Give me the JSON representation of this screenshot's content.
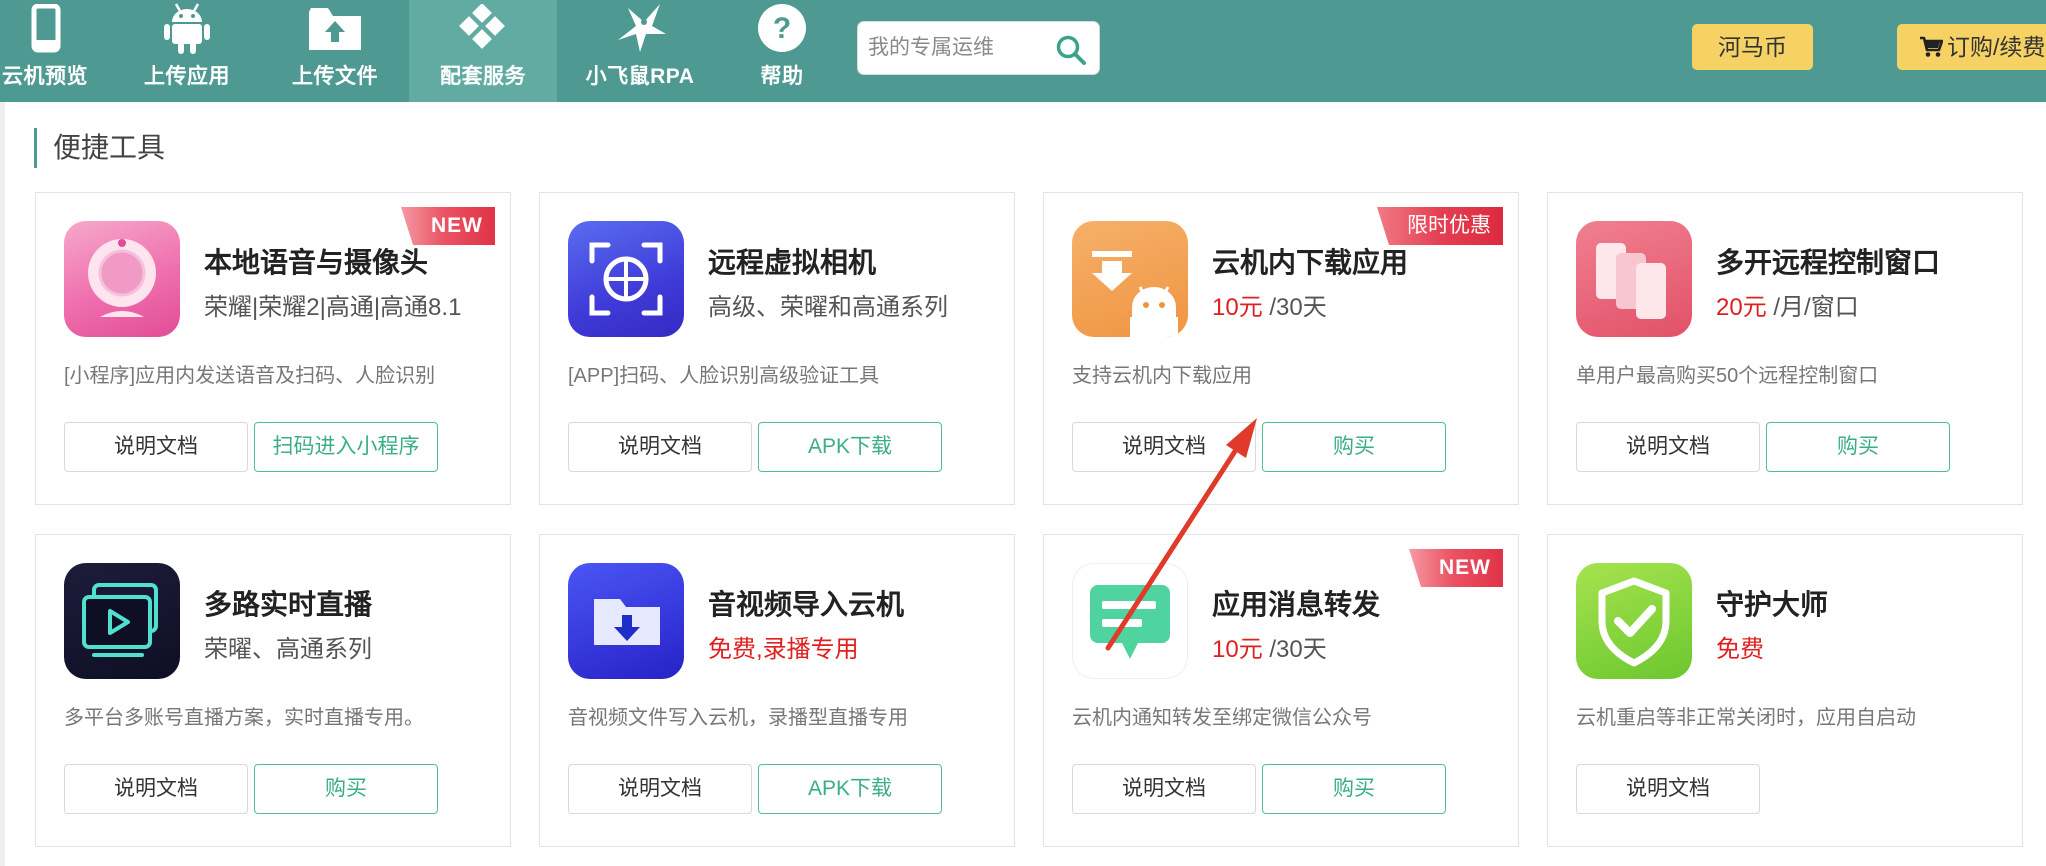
{
  "nav": {
    "items": [
      {
        "label": "云机预览",
        "icon": "phone-icon"
      },
      {
        "label": "上传应用",
        "icon": "android-icon"
      },
      {
        "label": "上传文件",
        "icon": "folder-upload-icon"
      },
      {
        "label": "配套服务",
        "icon": "diamond-grid-icon",
        "active": true
      },
      {
        "label": "小飞鼠RPA",
        "icon": "flying-squirrel-icon"
      },
      {
        "label": "帮助",
        "icon": "help-icon"
      }
    ],
    "search_placeholder": "我的专属运维",
    "coin_label": "河马币",
    "order_label": "订购/续费"
  },
  "section": {
    "title": "便捷工具"
  },
  "cards": [
    {
      "title": "本地语音与摄像头",
      "subtitle": "荣耀|荣耀2|高通|高通8.1",
      "desc": "[小程序]应用内发送语音及扫码、人脸识别",
      "badge": "NEW",
      "doc_label": "说明文档",
      "action_label": "扫码进入小程序",
      "icon": "webcam-icon"
    },
    {
      "title": "远程虚拟相机",
      "subtitle": "高级、荣曜和高通系列",
      "desc": "[APP]扫码、人脸识别高级验证工具",
      "doc_label": "说明文档",
      "action_label": "APK下载",
      "icon": "scan-camera-icon"
    },
    {
      "title": "云机内下载应用",
      "price": "10元",
      "period": " /30天",
      "desc": "支持云机内下载应用",
      "badge": "限时优惠",
      "doc_label": "说明文档",
      "action_label": "购买",
      "icon": "android-download-icon"
    },
    {
      "title": "多开远程控制窗口",
      "price": "20元",
      "period": " /月/窗口",
      "desc": "单用户最高购买50个远程控制窗口",
      "doc_label": "说明文档",
      "action_label": "购买",
      "icon": "multi-window-icon"
    },
    {
      "title": "多路实时直播",
      "subtitle": "荣曜、高通系列",
      "desc": "多平台多账号直播方案，实时直播专用。",
      "doc_label": "说明文档",
      "action_label": "购买",
      "icon": "live-stream-icon"
    },
    {
      "title": "音视频导入云机",
      "subtitle": "免费,录播专用",
      "desc": "音视频文件写入云机，录播型直播专用",
      "doc_label": "说明文档",
      "action_label": "APK下载",
      "icon": "media-import-icon"
    },
    {
      "title": "应用消息转发",
      "price": "10元",
      "period": " /30天",
      "desc": "云机内通知转发至绑定微信公众号",
      "badge": "NEW",
      "doc_label": "说明文档",
      "action_label": "购买",
      "icon": "message-forward-icon"
    },
    {
      "title": "守护大师",
      "subtitle": "免费",
      "desc": "云机重启等非正常关闭时，应用自启动",
      "doc_label": "说明文档",
      "icon": "shield-check-icon"
    }
  ],
  "colors": {
    "nav_bg": "#4e9a92",
    "nav_active": "#62aba3",
    "accent_green": "#3cae86",
    "price_red": "#e02020",
    "coin_yellow": "#f6d265",
    "arrow_red": "#e03a2a"
  }
}
